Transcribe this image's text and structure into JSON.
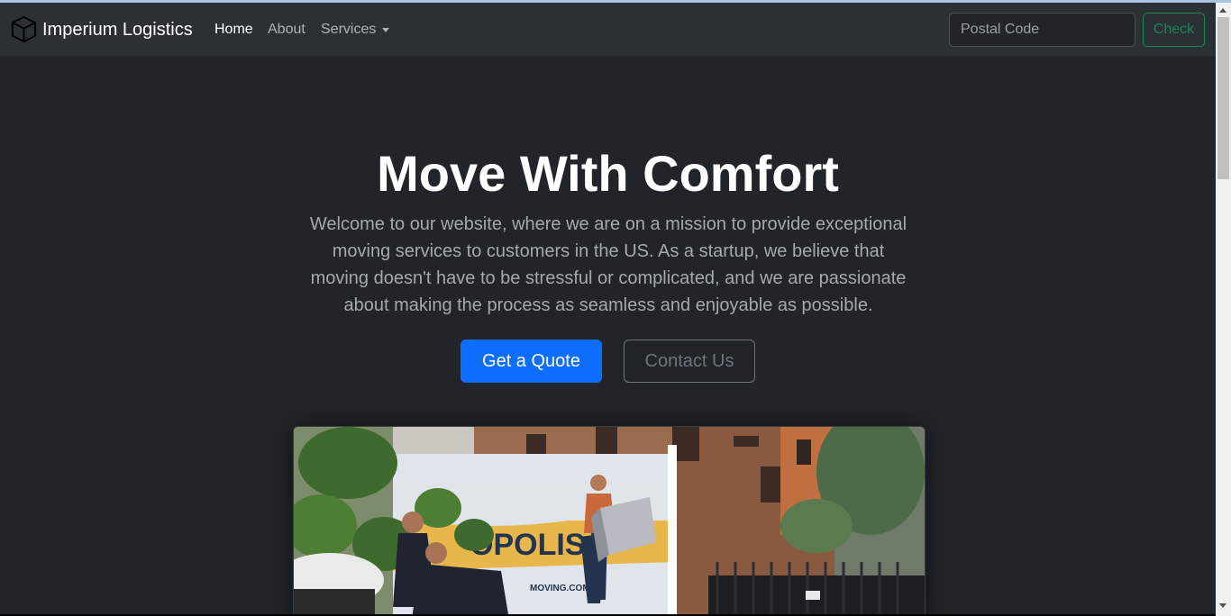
{
  "navbar": {
    "brand": "Imperium Logistics",
    "brand_icon": "box-icon",
    "links": [
      {
        "label": "Home",
        "active": true
      },
      {
        "label": "About",
        "active": false
      },
      {
        "label": "Services",
        "active": false,
        "dropdown": true
      }
    ],
    "search": {
      "placeholder": "Postal Code",
      "value": ""
    },
    "check_label": "Check"
  },
  "hero": {
    "title": "Move With Comfort",
    "lead": "Welcome to our website, where we are on a mission to provide exceptional moving services to customers in the US. As a startup, we believe that moving doesn't have to be stressful or complicated, and we are passionate about making the process as seamless and enjoyable as possible.",
    "primary_button": "Get a Quote",
    "secondary_button": "Contact Us"
  },
  "colors": {
    "page_bg": "#212529",
    "navbar_bg": "#2b3035",
    "primary": "#0d6efd",
    "success": "#198754",
    "secondary": "#6c757d"
  }
}
